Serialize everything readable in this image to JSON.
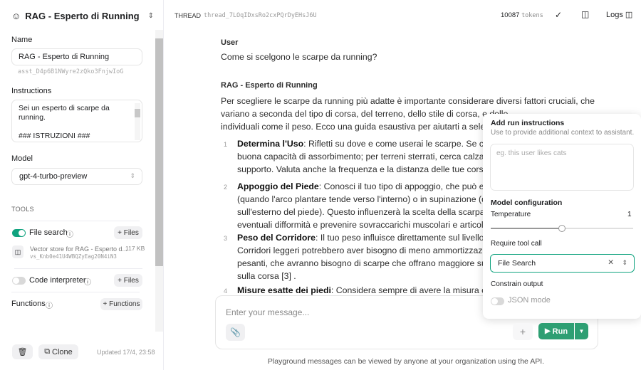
{
  "sidebar": {
    "assistant_title": "RAG - Esperto di Running",
    "name_label": "Name",
    "name_value": "RAG - Esperto di Running",
    "assistant_id": "asst_D4p6B1NWyre2zQko3FnjwIoG",
    "instructions_label": "Instructions",
    "instructions_lines": [
      "Sei un esperto di scarpe da",
      "running.",
      "",
      "### ISTRUZIONI ###"
    ],
    "model_label": "Model",
    "model_value": "gpt-4-turbo-preview",
    "tools_label": "TOOLS",
    "file_search": {
      "label": "File search",
      "enabled": true,
      "files_button": "+ Files",
      "store_name": "Vector store for RAG - Esperto d...",
      "store_id": "vs_Knb0e41U4WBQZyEag20N4iN3",
      "store_size": "117 KB"
    },
    "code_interpreter": {
      "label": "Code interpreter",
      "enabled": false,
      "files_button": "+ Files"
    },
    "functions": {
      "label": "Functions",
      "button": "+ Functions"
    },
    "clone_label": "Clone",
    "updated": "Updated 17/4, 23:58"
  },
  "header": {
    "thread_label": "THREAD",
    "thread_id": "thread_7LOqIDxsRo2cxPQrDyEHsJ6U",
    "token_count": "10087",
    "tokens_label": "tokens",
    "logs_label": "Logs"
  },
  "thread": {
    "user_role": "User",
    "user_message": "Come si scelgono le scarpe da running?",
    "assistant_role": "RAG - Esperto di Running",
    "intro_lines": [
      "Per scegliere le scarpe da running più adatte è importante considerare diversi fattori cruciali, che",
      "variano a seconda del tipo di corsa, del terreno, dello stile di corsa, e delle",
      "individuali come il peso. Ecco una guida esaustiva per aiutarti a seleziona"
    ],
    "items": [
      {
        "num": "1",
        "title": "Determina l'Uso",
        "lines": [
          ": Rifletti su dove e come userai le scarpe. Se corri su",
          "buona capacità di assorbimento; per terreni sterrati, cerca calzature",
          "supporto. Valuta anche la frequenza e la distanza delle tue corse [1]"
        ]
      },
      {
        "num": "2",
        "title": "Appoggio del Piede",
        "lines": [
          ": Conosci il tuo tipo di appoggio, che può essere",
          "(quando l'arco plantare tende verso l'interno) o in supinazione (quand",
          "sull'esterno del piede). Questo influenzerà la scelta della scarpa più a",
          "eventuali difformità e prevenire sovraccarichi muscolari e articolari ["
        ]
      },
      {
        "num": "3",
        "title": "Peso del Corridore",
        "lines": [
          ": Il tuo peso influisce direttamente sul livello di am",
          "Corridori leggeri potrebbero aver bisogno di meno ammortizzazione",
          "pesanti, che avranno bisogno di scarpe che offrano maggiore suppor",
          "sulla corsa [3] ."
        ]
      },
      {
        "num": "4",
        "title": "Misure esatte dei piedi",
        "lines": [
          ": Considera sempre di avere la misura corretta"
        ]
      }
    ]
  },
  "composer": {
    "placeholder": "Enter your message...",
    "run_label": "Run",
    "disclaimer": "Playground messages can be viewed by anyone at your organization using the API."
  },
  "run_popover": {
    "title": "Add run instructions",
    "subtitle": "Use to provide additional context to assistant.",
    "placeholder": "eg. this user likes cats",
    "model_config_label": "Model configuration",
    "temperature_label": "Temperature",
    "temperature_value": "1",
    "temperature_fraction": 0.5,
    "require_tool_label": "Require tool call",
    "require_tool_value": "File Search",
    "constrain_label": "Constrain output",
    "json_mode_label": "JSON mode",
    "json_mode_enabled": false
  },
  "colors": {
    "accent": "#10a37f",
    "run_button": "#2e9f73"
  }
}
